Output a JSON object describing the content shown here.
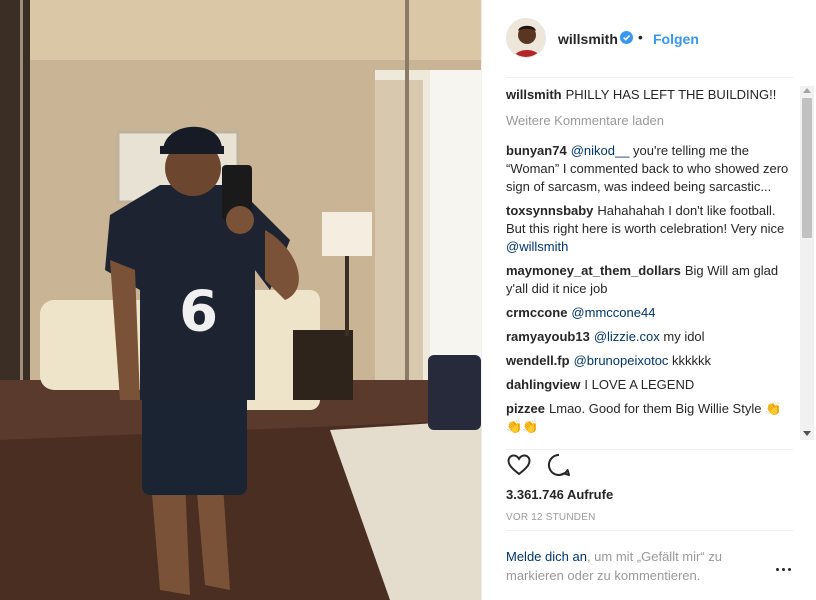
{
  "post": {
    "username": "willsmith",
    "follow_label": "Folgen",
    "separator": "•",
    "caption": {
      "user": "willsmith",
      "text": "PHILLY HAS LEFT THE BUILDING!!"
    },
    "load_more_label": "Weitere Kommentare laden",
    "comments": [
      {
        "user": "bunyan74",
        "mention": "@nikod__",
        "text": " you're telling me the “Woman” I commented back to who showed zero sign of sarcasm, was indeed being sarcastic..."
      },
      {
        "user": "toxsynnsbaby",
        "text": "Hahahahah I don't like football. But this right here is worth celebration! Very nice ",
        "mention_after": "@willsmith"
      },
      {
        "user": "maymoney_at_them_dollars",
        "text": "Big Will am glad y'all did it nice job"
      },
      {
        "user": "crmccone",
        "mention": "@mmccone44",
        "text": ""
      },
      {
        "user": "ramyayoub13",
        "mention": "@lizzie.cox",
        "text": " my idol"
      },
      {
        "user": "wendell.fp",
        "mention": "@brunopeixotoc",
        "text": " kkkkkk"
      },
      {
        "user": "dahlingview",
        "text": "I LOVE A LEGEND"
      },
      {
        "user": "pizzee",
        "text": "Lmao. Good for them Big Willie Style 👏👏👏"
      }
    ],
    "views": "3.361.746 Aufrufe",
    "timestamp": "VOR 12 STUNDEN",
    "footer": {
      "login_link": "Melde dich an",
      "rest": ", um mit „Gefällt mir“ zu markieren oder zu kommentieren."
    }
  },
  "colors": {
    "link_blue": "#3897f0",
    "mention_blue": "#003569",
    "muted_gray": "#999999",
    "verified_blue": "#3897f0"
  },
  "icons": {
    "like": "heart-icon",
    "comment": "comment-bubble-icon",
    "verified": "verified-badge-icon",
    "more": "more-options-icon"
  }
}
